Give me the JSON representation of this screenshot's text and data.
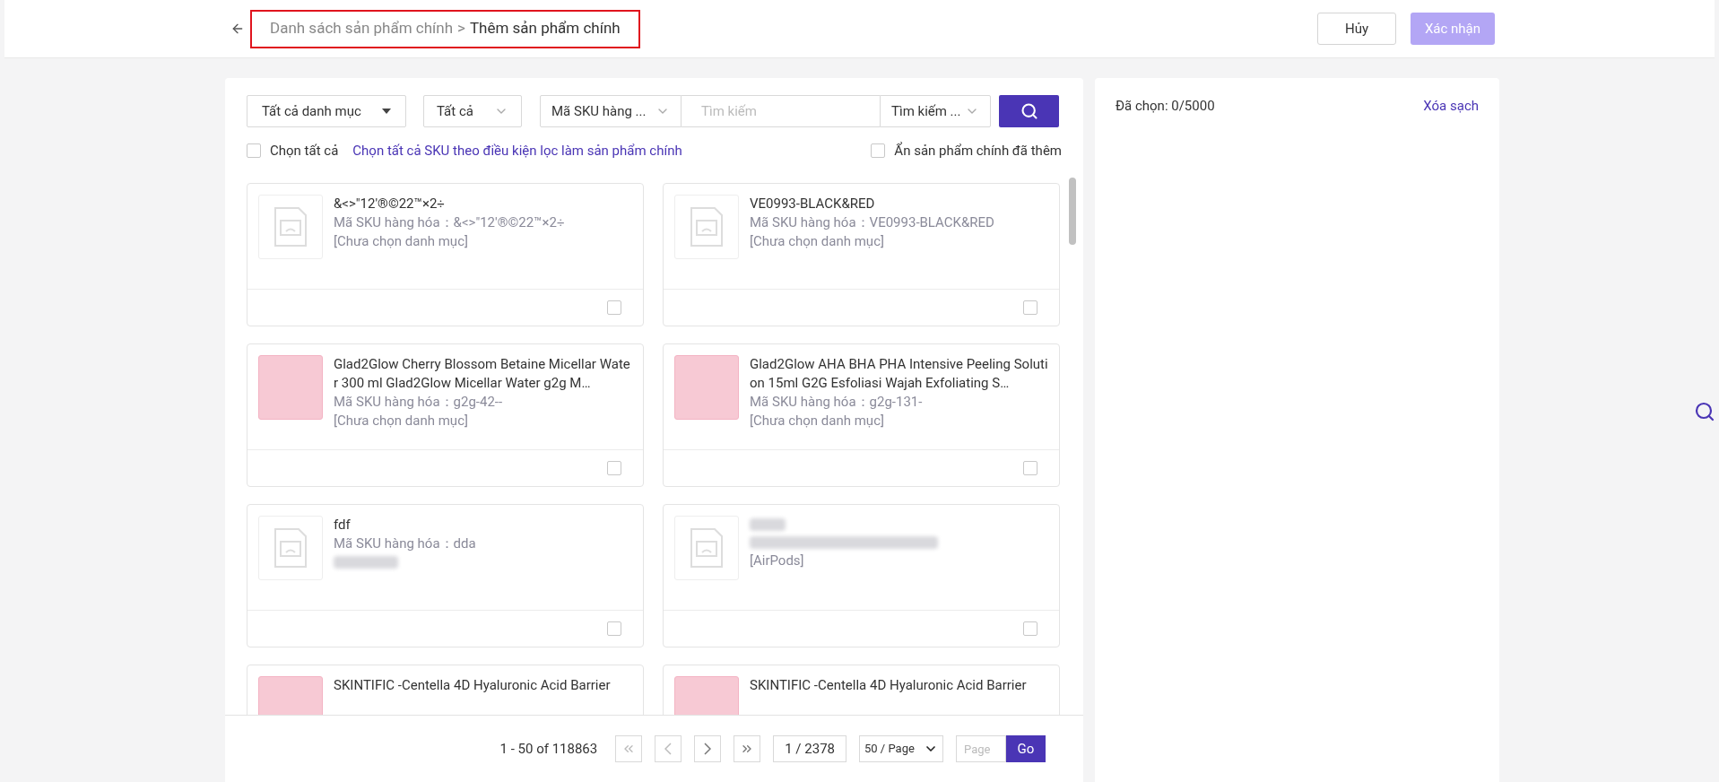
{
  "header": {
    "breadcrumb_parent": "Danh sách sản phẩm chính",
    "separator": ">",
    "breadcrumb_current": "Thêm sản phẩm chính",
    "buttons": [
      {
        "label": "Hủy",
        "kind": "secondary"
      },
      {
        "label": "Xác nhận",
        "kind": "primary",
        "disabled": true
      }
    ]
  },
  "filters": {
    "category": "Tất cả danh mục",
    "status": "Tất cả",
    "search_field": "Mã SKU hàng ...",
    "search": {
      "placeholder": "Tìm kiếm"
    },
    "search_mode": "Tìm kiếm ..."
  },
  "options": {
    "select_all": {
      "label": "Chọn tất cả",
      "checked": false
    },
    "select_by_filter_link": "Chọn tất cả SKU theo điều kiện lọc làm sản phẩm chính",
    "hide_added": {
      "label": "Ẩn sản phẩm chính đã thêm",
      "checked": false
    }
  },
  "products": [
    {
      "name": "&<>\"12'®©22™×2÷",
      "sku_label": "Mã SKU hàng hóa：",
      "sku": "&<>\"12'®©22™×2÷",
      "category": "[Chưa chọn danh mục]",
      "kind": "no_image",
      "checked": false
    },
    {
      "name": "VE0993-BLACK&RED",
      "sku_label": "Mã SKU hàng hóa：",
      "sku": "VE0993-BLACK&RED",
      "category": "[Chưa chọn danh mục]",
      "kind": "no_image",
      "checked": false
    },
    {
      "name": "Glad2Glow Cherry Blossom Betaine Micellar Water 300 ml Glad2Glow Micellar Water g2g M…",
      "sku_label": "Mã SKU hàng hóa：",
      "sku": "g2g-42--",
      "category": "[Chưa chọn danh mục]",
      "kind": "photo",
      "checked": false
    },
    {
      "name": "Glad2Glow AHA BHA PHA Intensive Peeling Solution 15ml G2G Esfoliasi Wajah Exfoliating S…",
      "sku_label": "Mã SKU hàng hóa：",
      "sku": "g2g-131-",
      "category": "[Chưa chọn danh mục]",
      "kind": "photo",
      "checked": false
    },
    {
      "name": "fdf",
      "sku_label": "Mã SKU hàng hóa：",
      "sku": "dda",
      "category_blurred": true,
      "kind": "no_image",
      "checked": false
    },
    {
      "name_blurred": true,
      "sku_blurred": true,
      "category": "[AirPods]",
      "kind": "no_image",
      "checked": false
    },
    {
      "name": "SKINTIFIC -Centella 4D Hyaluronic Acid Barrier",
      "kind": "photo"
    },
    {
      "name": "SKINTIFIC -Centella 4D Hyaluronic Acid Barrier",
      "kind": "photo"
    }
  ],
  "pagination": {
    "range": "1 - 50 of 118863",
    "page": "1 / 2378",
    "page_size": "50 / Page",
    "jump": {
      "placeholder": "Page"
    },
    "go": "Go"
  },
  "selected_panel": {
    "count": "Đã chọn: 0/5000",
    "clear": "Xóa sạch"
  }
}
